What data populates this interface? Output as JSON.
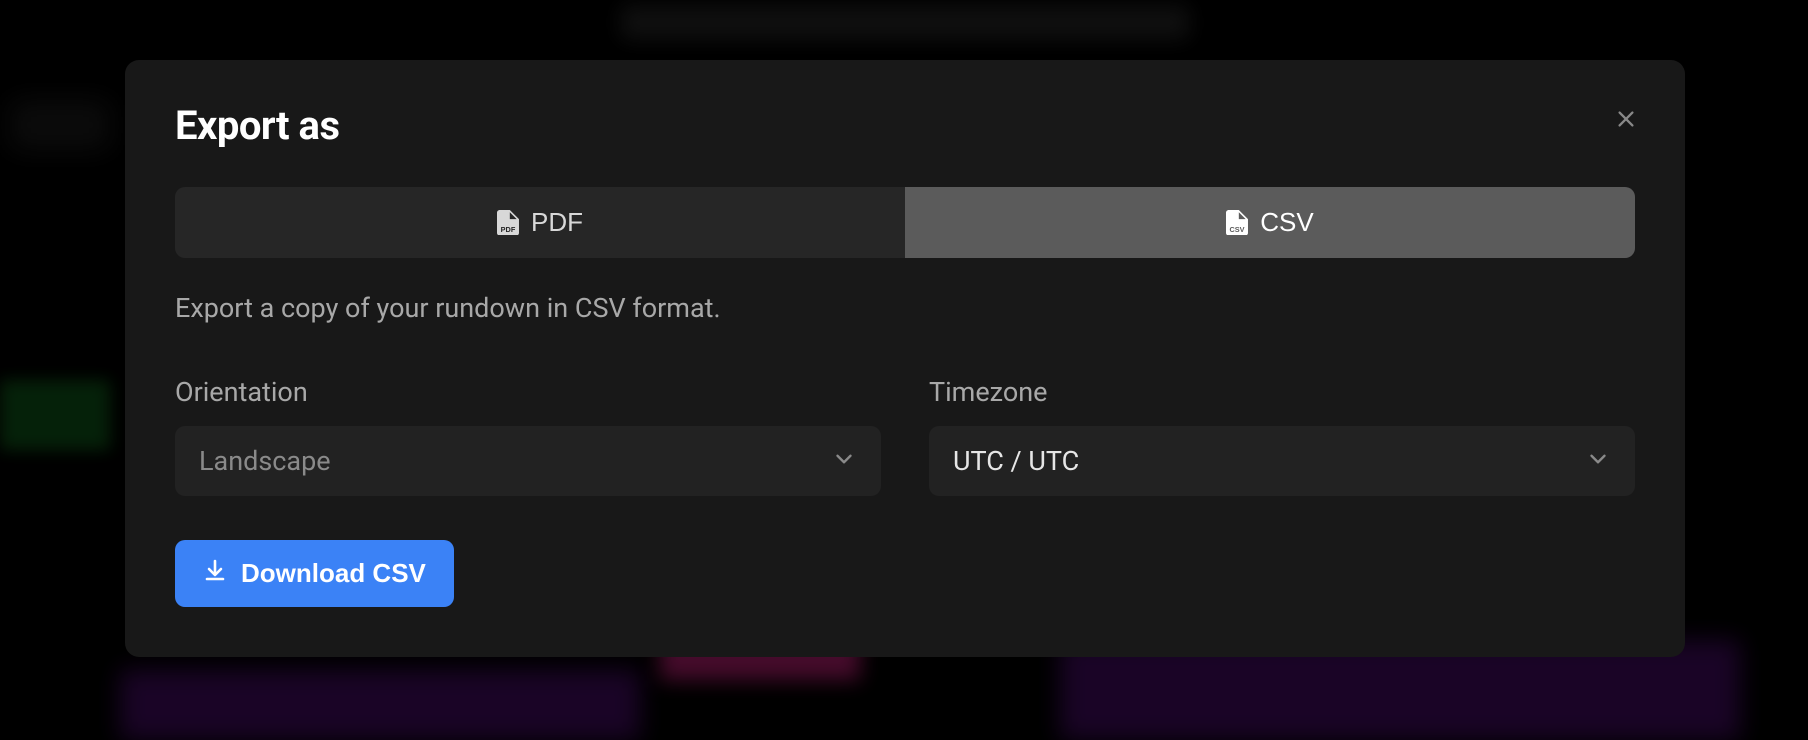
{
  "modal": {
    "title": "Export as",
    "tabs": {
      "pdf": {
        "label": "PDF"
      },
      "csv": {
        "label": "CSV"
      }
    },
    "description": "Export a copy of your rundown in CSV format.",
    "form": {
      "orientation": {
        "label": "Orientation",
        "value": "Landscape"
      },
      "timezone": {
        "label": "Timezone",
        "value": "UTC / UTC"
      }
    },
    "download_button": "Download CSV"
  }
}
